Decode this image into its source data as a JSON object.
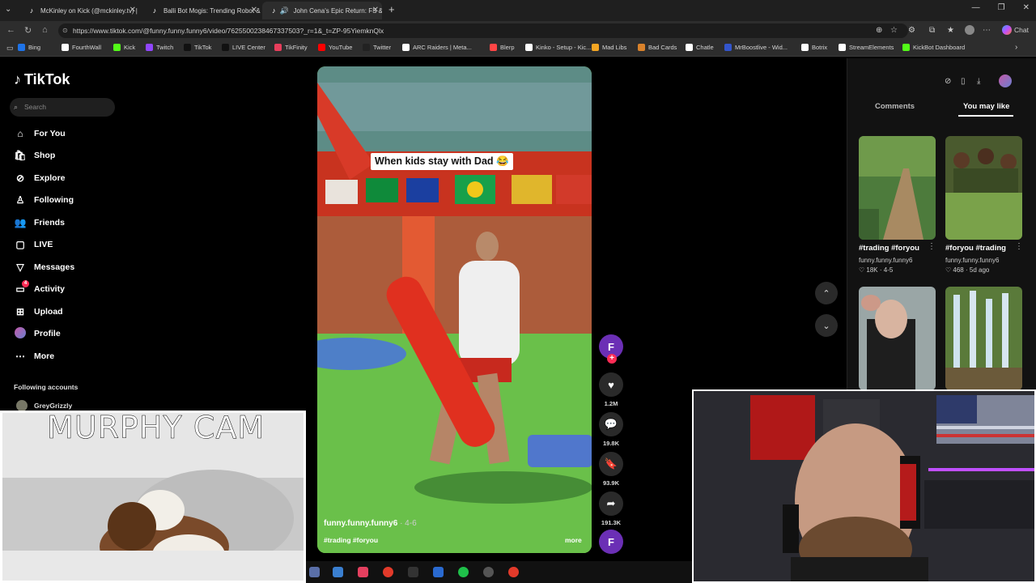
{
  "browser": {
    "tabs": [
      {
        "title": "McKinley on Kick (@mckinley.tv) |",
        "icon": "tiktok-icon"
      },
      {
        "title": "Balli Bot Mogis: Trending Robot &",
        "icon": "tiktok-icon"
      },
      {
        "title": "John Cena's Epic Return: FS &",
        "icon": "tiktok-icon",
        "active": true
      }
    ],
    "url": "https://www.tiktok.com/@funny.funny.funny6/video/7625500238467337503?_r=1&_t=ZP-95YiemknQlx",
    "chat_label": "Chat"
  },
  "bookmarks": [
    {
      "label": "Bing",
      "color": "#1e73e8"
    },
    {
      "label": "FourthWall",
      "color": "#ffffff"
    },
    {
      "label": "Kick",
      "color": "#53fc18"
    },
    {
      "label": "Twitch",
      "color": "#9146ff"
    },
    {
      "label": "TikTok",
      "color": "#111111"
    },
    {
      "label": "LIVE Center",
      "color": "#111111"
    },
    {
      "label": "TikFinity",
      "color": "#e83e5c"
    },
    {
      "label": "YouTube",
      "color": "#ff0000"
    },
    {
      "label": "Twitter",
      "color": "#222222"
    },
    {
      "label": "ARC Raiders | Meta...",
      "color": "#ffffff"
    },
    {
      "label": "Blerp",
      "color": "#ff4545"
    },
    {
      "label": "Kinko - Setup - Kic...",
      "color": "#ffffff"
    },
    {
      "label": "Mad Libs",
      "color": "#f5a623"
    },
    {
      "label": "Bad Cards",
      "color": "#d9822b"
    },
    {
      "label": "Chatle",
      "color": "#ffffff"
    },
    {
      "label": "MrBoostlive - Wid...",
      "color": "#3355cc"
    },
    {
      "label": "Botrix",
      "color": "#ffffff"
    },
    {
      "label": "StreamElements",
      "color": "#ffffff"
    },
    {
      "label": "KickBot Dashboard",
      "color": "#53fc18"
    }
  ],
  "tiktok": {
    "logo": "TikTok",
    "search_placeholder": "Search",
    "nav": [
      {
        "label": "For You",
        "icon": "home-icon"
      },
      {
        "label": "Shop",
        "icon": "shop-icon"
      },
      {
        "label": "Explore",
        "icon": "compass-icon"
      },
      {
        "label": "Following",
        "icon": "following-icon"
      },
      {
        "label": "Friends",
        "icon": "friends-icon"
      },
      {
        "label": "LIVE",
        "icon": "live-icon"
      },
      {
        "label": "Messages",
        "icon": "messages-icon"
      },
      {
        "label": "Activity",
        "icon": "activity-icon",
        "badge": "4"
      },
      {
        "label": "Upload",
        "icon": "upload-icon"
      },
      {
        "label": "Profile",
        "icon": "profile-icon"
      },
      {
        "label": "More",
        "icon": "more-icon"
      }
    ],
    "following_heading": "Following accounts",
    "following_accounts": [
      "GreyGrizzly"
    ]
  },
  "video": {
    "caption_overlay": "When kids stay with Dad 😂",
    "author": "funny.funny.funny6",
    "date": "· 4-6",
    "hashtags": "#trading #foryou",
    "more_label": "more",
    "avatar_letter": "F",
    "likes": "1.2M",
    "comments": "19.8K",
    "saves": "93.9K",
    "shares": "191.3K"
  },
  "side_panel": {
    "tab_comments": "Comments",
    "tab_you_may_like": "You may like",
    "items": [
      {
        "title": "#trading #foryou",
        "user": "funny.funny.funny6",
        "likes": "18K",
        "date": "4-5"
      },
      {
        "title": "#foryou #trading",
        "user": "funny.funny.funny6",
        "likes": "468",
        "date": "5d ago"
      },
      {
        "title": "",
        "user": "",
        "likes": "",
        "date": ""
      },
      {
        "title": "",
        "user": "",
        "likes": "",
        "date": ""
      }
    ]
  },
  "overlays": {
    "murphy_cam_label": "MURPHY CAM"
  }
}
